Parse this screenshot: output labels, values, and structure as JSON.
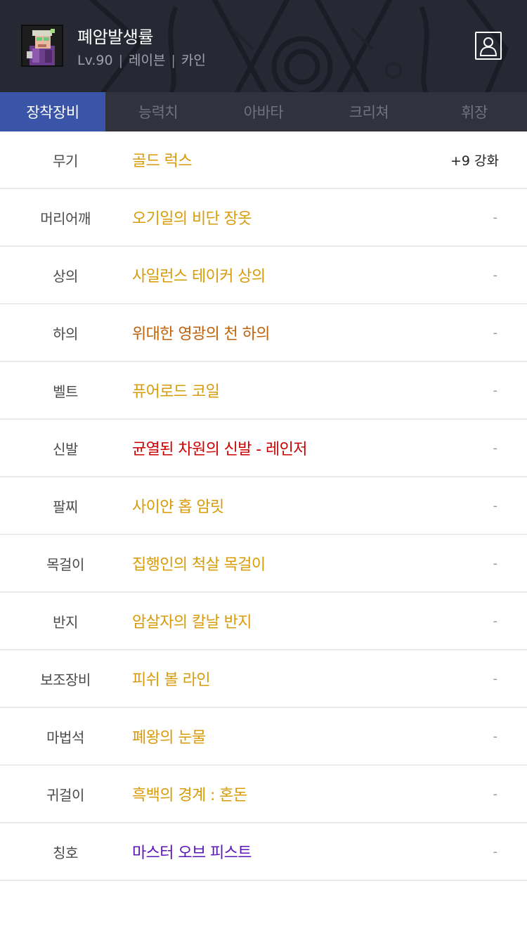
{
  "header": {
    "character_name": "폐암발생률",
    "level": "Lv.90",
    "job": "레이븐",
    "server": "카인",
    "separator": "|",
    "avatar_icon": "character-portrait-icon",
    "profile_icon": "profile-card-icon"
  },
  "tabs": [
    {
      "label": "장착장비",
      "active": true
    },
    {
      "label": "능력치",
      "active": false
    },
    {
      "label": "아바타",
      "active": false
    },
    {
      "label": "크리쳐",
      "active": false
    },
    {
      "label": "휘장",
      "active": false
    }
  ],
  "colors": {
    "header_bg": "#262833",
    "tab_bar_bg": "#30323e",
    "tab_active_bg": "#3a55a8",
    "epic": "#d89b0a",
    "legendary": "#c0620b",
    "unique_red": "#cc0000",
    "title_purple": "#5a14b8"
  },
  "equipment": [
    {
      "slot": "무기",
      "item": "골드 럭스",
      "color": "#d89b0a",
      "extra": "+9 강화"
    },
    {
      "slot": "머리어깨",
      "item": "오기일의 비단 장옷",
      "color": "#d89b0a",
      "extra": "-"
    },
    {
      "slot": "상의",
      "item": "사일런스 테이커 상의",
      "color": "#d89b0a",
      "extra": "-"
    },
    {
      "slot": "하의",
      "item": "위대한 영광의 천 하의",
      "color": "#c0620b",
      "extra": "-"
    },
    {
      "slot": "벨트",
      "item": "퓨어로드 코일",
      "color": "#d89b0a",
      "extra": "-"
    },
    {
      "slot": "신발",
      "item": "균열된 차원의 신발 - 레인저",
      "color": "#cc0000",
      "extra": "-"
    },
    {
      "slot": "팔찌",
      "item": "사이얀 홉 암릿",
      "color": "#d89b0a",
      "extra": "-"
    },
    {
      "slot": "목걸이",
      "item": "집행인의 척살 목걸이",
      "color": "#d89b0a",
      "extra": "-"
    },
    {
      "slot": "반지",
      "item": "암살자의 칼날 반지",
      "color": "#d89b0a",
      "extra": "-"
    },
    {
      "slot": "보조장비",
      "item": "피쉬 볼 라인",
      "color": "#d89b0a",
      "extra": "-"
    },
    {
      "slot": "마법석",
      "item": "폐왕의 눈물",
      "color": "#d89b0a",
      "extra": "-"
    },
    {
      "slot": "귀걸이",
      "item": "흑백의 경계 : 혼돈",
      "color": "#d89b0a",
      "extra": "-"
    },
    {
      "slot": "칭호",
      "item": "마스터 오브 피스트",
      "color": "#5a14b8",
      "extra": "-"
    }
  ]
}
